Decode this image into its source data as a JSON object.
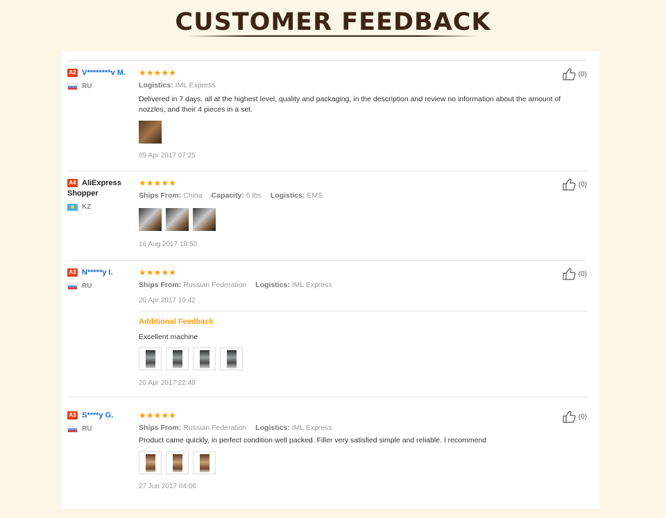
{
  "page": {
    "title": "CUSTOMER FEEDBACK"
  },
  "colors": {
    "title": "#3e2414",
    "star": "#ff9d00",
    "user_link": "#1a6bd0",
    "badge": "#e0421b",
    "additional_feedback": "#f7a11b"
  },
  "reviews": [
    {
      "badge": "A2",
      "user": "V********v M.",
      "country": "RU",
      "flag_icon": "flag-ru-icon",
      "stars": "★★★★★",
      "rating": 5,
      "meta": {
        "logistics_label": "Logistics:",
        "logistics": "IML Express"
      },
      "text": "Delivered in 7 days. all at the highest level, quality and packaging, in the description and review no information about the amount of nozzles, and their 4 pieces in a set.",
      "photo_count": 1,
      "date": "09 Apr 2017 07:25",
      "likes": "(0)"
    },
    {
      "badge": "A4",
      "user": "AliExpress Shopper",
      "country": "KZ",
      "flag_icon": "flag-kz-icon",
      "stars": "★★★★★",
      "rating": 5,
      "meta": {
        "ships_label": "Ships From:",
        "ships": "China",
        "capacity_label": "Capacity:",
        "capacity": "6 lbs",
        "logistics_label": "Logistics:",
        "logistics": "EMS"
      },
      "photo_count": 3,
      "date": "16 Aug 2017 18:50",
      "likes": "(0)"
    },
    {
      "badge": "A3",
      "user": "N*****y I.",
      "country": "RU",
      "flag_icon": "flag-ru-icon",
      "stars": "★★★★★",
      "rating": 5,
      "meta": {
        "ships_label": "Ships From:",
        "ships": "Russian Federation",
        "logistics_label": "Logistics:",
        "logistics": "IML Express"
      },
      "date": "20 Apr 2017 19:42",
      "additional_label": "Additional Feedback",
      "additional_text": "Excellent machine",
      "additional_photo_count": 4,
      "additional_date": "20 Apr 2017 22:48",
      "likes": "(0)"
    },
    {
      "badge": "A3",
      "user": "S****y G.",
      "country": "RU",
      "flag_icon": "flag-ru-icon",
      "stars": "★★★★★",
      "rating": 5,
      "meta": {
        "ships_label": "Ships From:",
        "ships": "Russian Federation",
        "logistics_label": "Logistics:",
        "logistics": "IML Express"
      },
      "text": "Product came quickly, in perfect condition well packed. Filler very satisfied simple and reliable. I recommend",
      "photo_count": 3,
      "date": "27 Jun 2017 04:06",
      "likes": "(0)"
    }
  ]
}
